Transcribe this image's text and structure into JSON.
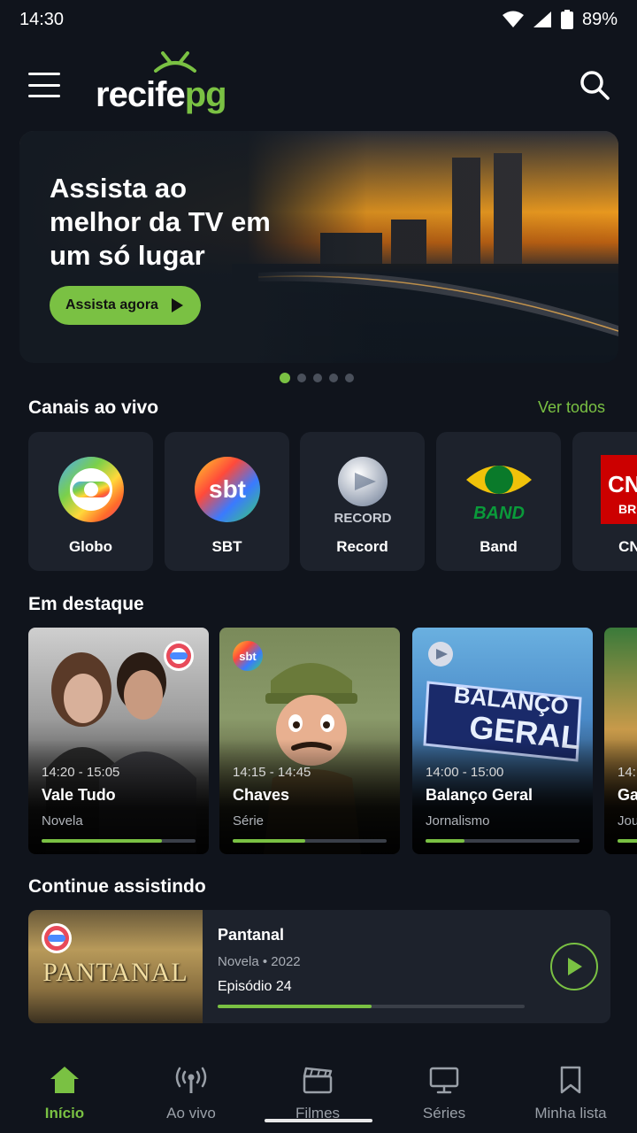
{
  "status_bar": {
    "time": "14:30",
    "battery": "89%"
  },
  "header": {
    "logo_part1": "recife",
    "logo_part2": "pg"
  },
  "hero": {
    "title": "Assista ao melhor da TV em um só lugar",
    "button_label": "Assista agora",
    "slide_count": 5,
    "active_slide": 1
  },
  "live": {
    "section_title": "Canais ao vivo",
    "see_all": "Ver todos",
    "channels": [
      {
        "name": "Globo"
      },
      {
        "name": "SBT"
      },
      {
        "name": "Record"
      },
      {
        "name": "Band"
      },
      {
        "name": "CNN"
      }
    ]
  },
  "featured": {
    "section_title": "Em destaque",
    "items": [
      {
        "time": "14:20 - 15:05",
        "title": "Vale Tudo",
        "genre": "Novela",
        "progress": 0.78,
        "channel": "Globo"
      },
      {
        "time": "14:15 - 14:45",
        "title": "Chaves",
        "genre": "Série",
        "progress": 0.47,
        "channel": "SBT"
      },
      {
        "time": "14:00 - 15:00",
        "title": "Balanço Geral",
        "genre": "Jornalismo",
        "progress": 0.25,
        "channel": "Record",
        "art_text_1": "BALANÇO",
        "art_text_2": "GERAL"
      },
      {
        "time": "14:",
        "title": "Ga",
        "genre": "Jou",
        "progress": 0.3,
        "channel": ""
      }
    ]
  },
  "continue": {
    "section_title": "Continue assistindo",
    "item": {
      "title": "Pantanal",
      "meta": "Novela • 2022",
      "episode": "Episódio 24",
      "thumb_text": "PANTANAL",
      "progress": 0.5,
      "channel": "Globo"
    }
  },
  "logos": {
    "sbt": "sbt",
    "record": "RECORD",
    "band": "BAND",
    "cnn": "CNN",
    "cnn_sub": "BR"
  },
  "bottom_nav": [
    {
      "label": "Início",
      "icon": "home-icon",
      "active": true
    },
    {
      "label": "Ao vivo",
      "icon": "broadcast-icon",
      "active": false
    },
    {
      "label": "Filmes",
      "icon": "clapperboard-icon",
      "active": false
    },
    {
      "label": "Séries",
      "icon": "monitor-icon",
      "active": false
    },
    {
      "label": "Minha lista",
      "icon": "bookmark-icon",
      "active": false
    }
  ],
  "colors": {
    "accent": "#7ac143",
    "background": "#10141c",
    "card": "#1d222c"
  }
}
